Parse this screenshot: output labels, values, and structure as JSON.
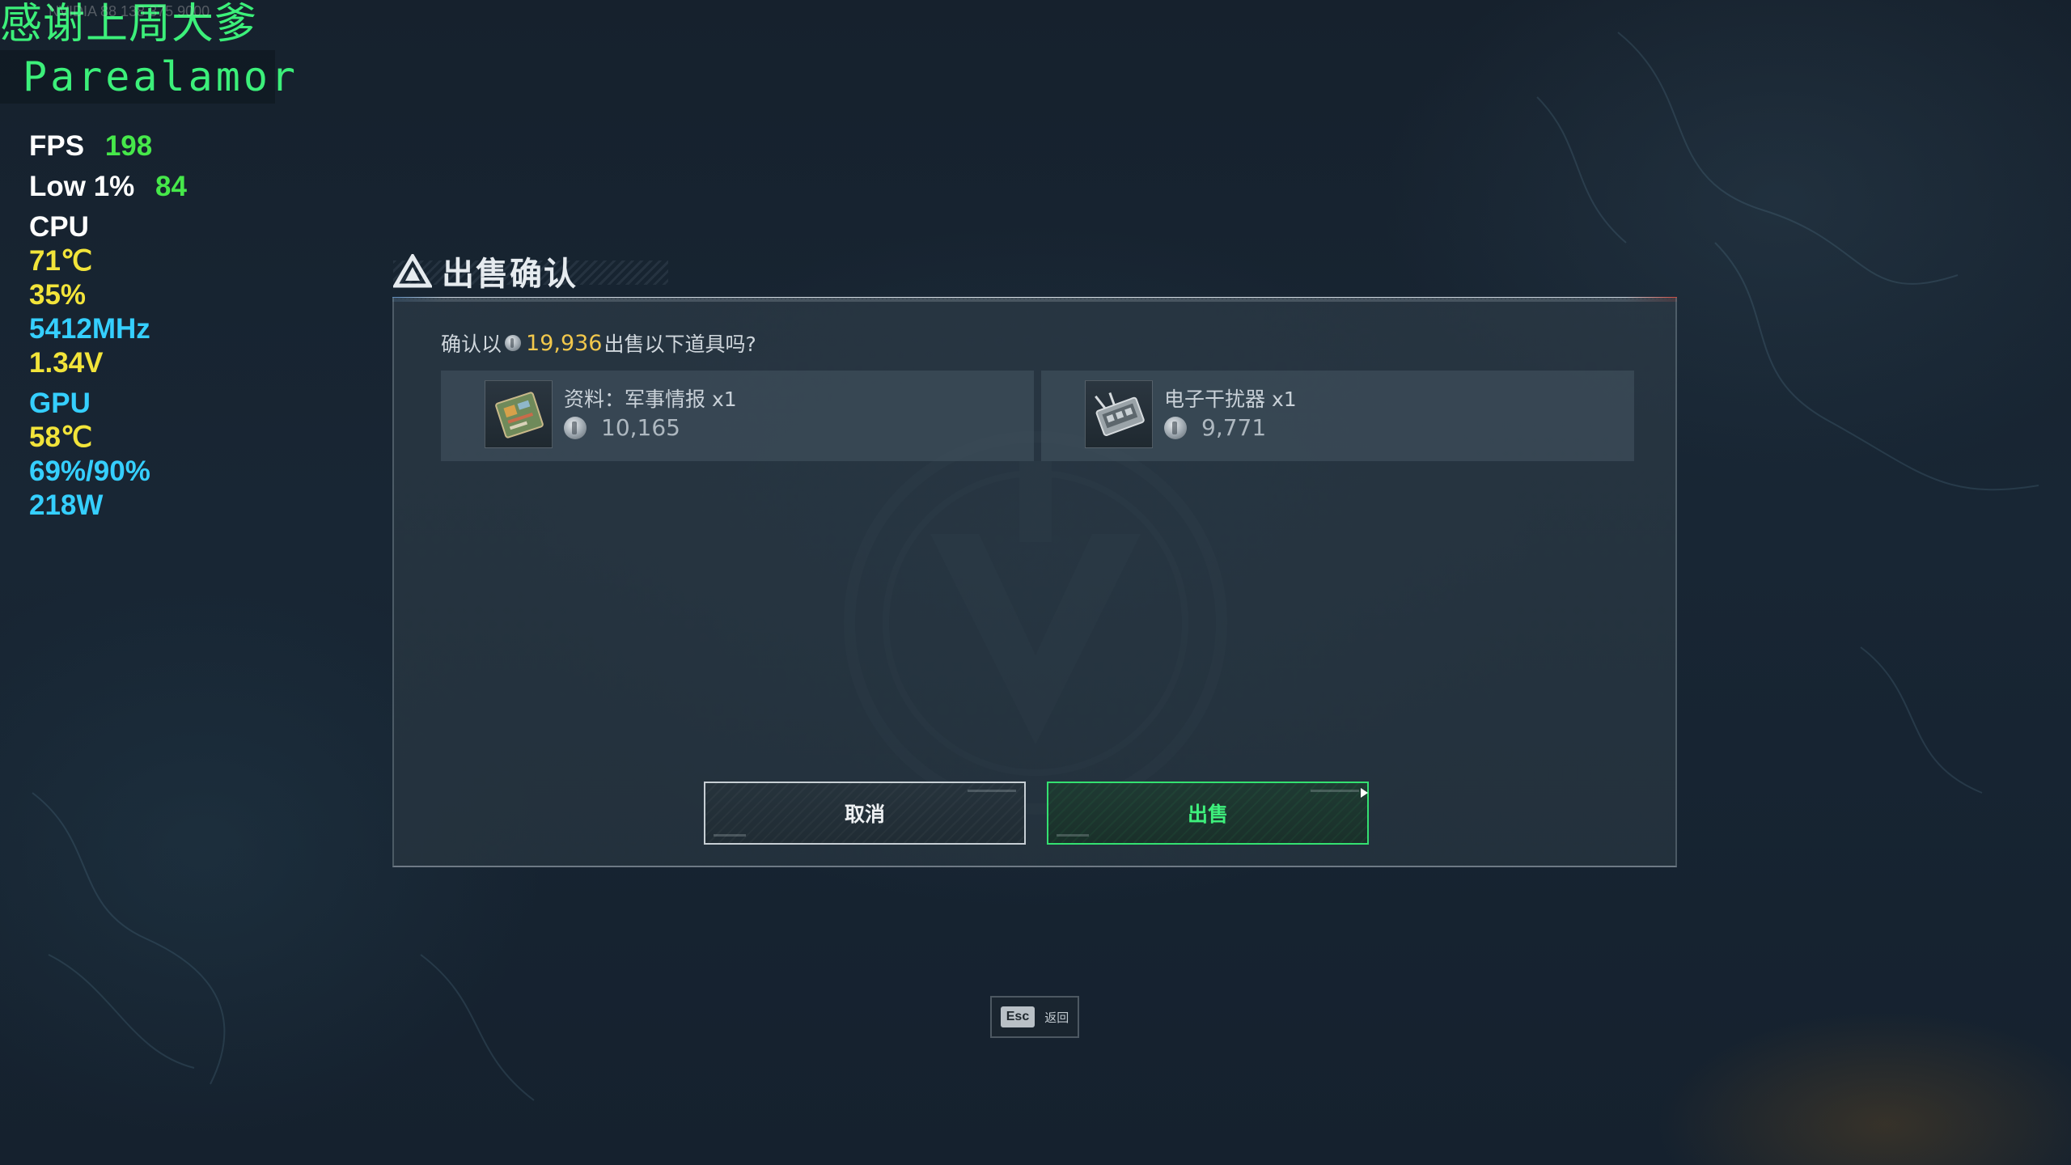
{
  "overlay": {
    "thanks": "感谢上周大爹",
    "thanks_sub": "NVIDIA 88 138 375 9000",
    "streamer": "Parealamor",
    "fps_label": "FPS",
    "fps": "198",
    "low_label": "Low 1%",
    "low": "84",
    "cpu_label": "CPU",
    "cpu_temp": "71℃",
    "cpu_usage": "35%",
    "cpu_clock": "5412MHz",
    "cpu_voltage": "1.34V",
    "gpu_label": "GPU",
    "gpu_temp": "58℃",
    "gpu_usage": "69%/90%",
    "gpu_power": "218W"
  },
  "dialog": {
    "title": "出售确认",
    "prompt_prefix": "确认以",
    "total": "19,936",
    "prompt_suffix": "出售以下道具吗?",
    "items": [
      {
        "name": "资料：军事情报 x1",
        "price": "10,165",
        "icon": "military-intel-chip-icon"
      },
      {
        "name": "电子干扰器 x1",
        "price": "9,771",
        "icon": "electronic-jammer-icon"
      }
    ],
    "cancel_label": "取消",
    "sell_label": "出售"
  },
  "footer": {
    "esc_key": "Esc",
    "esc_label": "返回"
  },
  "colors": {
    "accent_green": "#3ef07c",
    "price_gold": "#f2c84c",
    "fps_green": "#46e84a",
    "cpu_yellow": "#f2e43a",
    "gpu_cyan": "#35cfff"
  }
}
